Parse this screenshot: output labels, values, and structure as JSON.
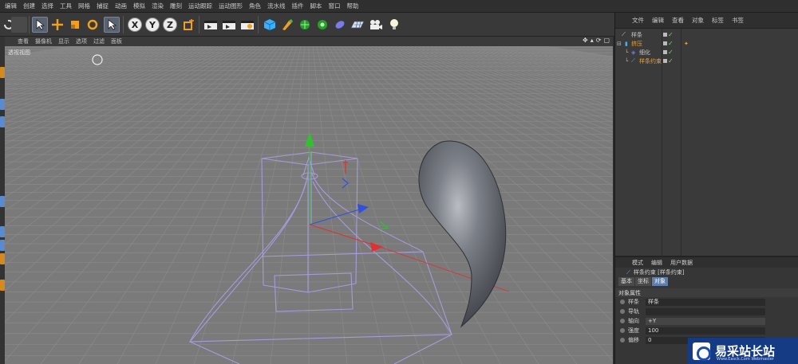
{
  "menubar": {
    "items": [
      "编辑",
      "创建",
      "选择",
      "工具",
      "网格",
      "捕捉",
      "动画",
      "模拟",
      "渲染",
      "雕刻",
      "运动跟踪",
      "运动图形",
      "角色",
      "流水线",
      "插件",
      "脚本",
      "窗口",
      "帮助"
    ]
  },
  "toolbar": {
    "axis_x": "X",
    "axis_y": "Y",
    "axis_z": "Z",
    "icons": [
      "undo-icon",
      "redo-icon",
      "select-arrow-icon",
      "move-icon",
      "scale-icon",
      "rotate-icon",
      "live-select-icon",
      "axis-x-icon",
      "axis-y-icon",
      "axis-z-icon",
      "coordinate-system-icon",
      "render-view-icon",
      "render-picture-icon",
      "render-settings-icon",
      "cube-icon",
      "pen-icon",
      "subdivision-icon",
      "array-icon",
      "deformer-icon",
      "floor-icon",
      "camera-icon",
      "light-icon"
    ]
  },
  "viewport": {
    "menu": [
      "查看",
      "摄像机",
      "显示",
      "选项",
      "过滤",
      "面板"
    ],
    "label": "透视视图",
    "nav_icons": [
      "move-view-icon",
      "zoom-view-icon",
      "rotate-view-icon",
      "toggle-view-icon"
    ]
  },
  "object_manager": {
    "menu": [
      "文件",
      "编辑",
      "查看",
      "对象",
      "标签",
      "书签"
    ],
    "rows": [
      {
        "name": "样条",
        "color": "#c8c8c8",
        "indent": 0
      },
      {
        "name": "挤压",
        "color": "#e9a23b",
        "indent": 0
      },
      {
        "name": "细化",
        "color": "#c8c8c8",
        "indent": 1
      },
      {
        "name": "样条约束",
        "color": "#e9a23b",
        "indent": 1
      }
    ]
  },
  "attributes": {
    "menu": [
      "模式",
      "编辑",
      "用户数据"
    ],
    "title": "样条约束 [样条约束]",
    "tabs": [
      "基本",
      "坐标",
      "对象"
    ],
    "active_tab": "对象",
    "section": "对象属性",
    "props": [
      {
        "label": "样条",
        "value": "样条"
      },
      {
        "label": "导轨",
        "value": ""
      },
      {
        "label": "轴向",
        "value": "+Y"
      },
      {
        "label": "强度",
        "value": "100"
      },
      {
        "label": "偏移",
        "value": "0"
      }
    ]
  },
  "watermark": {
    "main": "易采站长站",
    "sub": "Www.Easck.Com Webmaster"
  },
  "colors": {
    "accent": "#e9a23b",
    "axis_x": "#e03030",
    "axis_y": "#30c030",
    "axis_z": "#3050e0",
    "cage": "#a79bdc",
    "active_tab": "#607eaa"
  }
}
